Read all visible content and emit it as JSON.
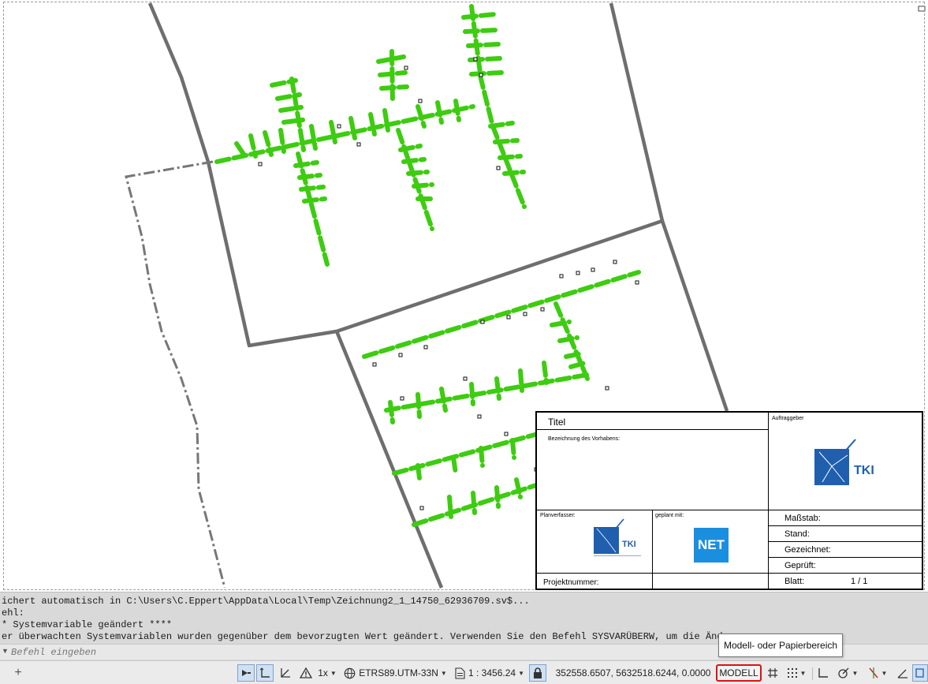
{
  "titleblock": {
    "titel": "Titel",
    "bezeichnung": "Bezeichnung des Vorhabens:",
    "auftraggeber": "Auftraggeber",
    "planverfasser": "Planverfasser:",
    "geplant_mit": "geplant mit:",
    "massstab": "Maßstab:",
    "stand": "Stand:",
    "gezeichnet": "Gezeichnet:",
    "geprueft": "Geprüft:",
    "blatt": "Blatt:",
    "blatt_value": "1 / 1",
    "projektnummer": "Projektnummer:",
    "logo_tki": "TKI",
    "logo_net": "NET",
    "brand_blue": "#1f5fae",
    "net_blue": "#1a8fe0"
  },
  "command_history": [
    "ichert automatisch in C:\\Users\\C.Eppert\\AppData\\Local\\Temp\\Zeichnung2_1_14750_62936709.sv$...",
    "ehl:",
    "* Systemvariable geändert ****",
    "er überwachten Systemvariablen wurden gegenüber dem bevorzugten Wert geändert. Verwenden Sie den Befehl SYSVARÜBERW, um die Änderu"
  ],
  "command_input": {
    "placeholder": "Befehl eingeben"
  },
  "statusbar": {
    "annotation_scale": "1x",
    "coord_system": "ETRS89.UTM-33N",
    "scale": "1 : 3456.24",
    "coordinates": "352558.6507, 5632518.6244, 0.0000",
    "model_button": "MODELL"
  },
  "tooltip": {
    "text": "Modell- oder Papierbereich"
  },
  "colors": {
    "cable_green": "#3dcc10",
    "boundary_grey": "#6e6e6e",
    "highlight_red": "#e01010"
  }
}
